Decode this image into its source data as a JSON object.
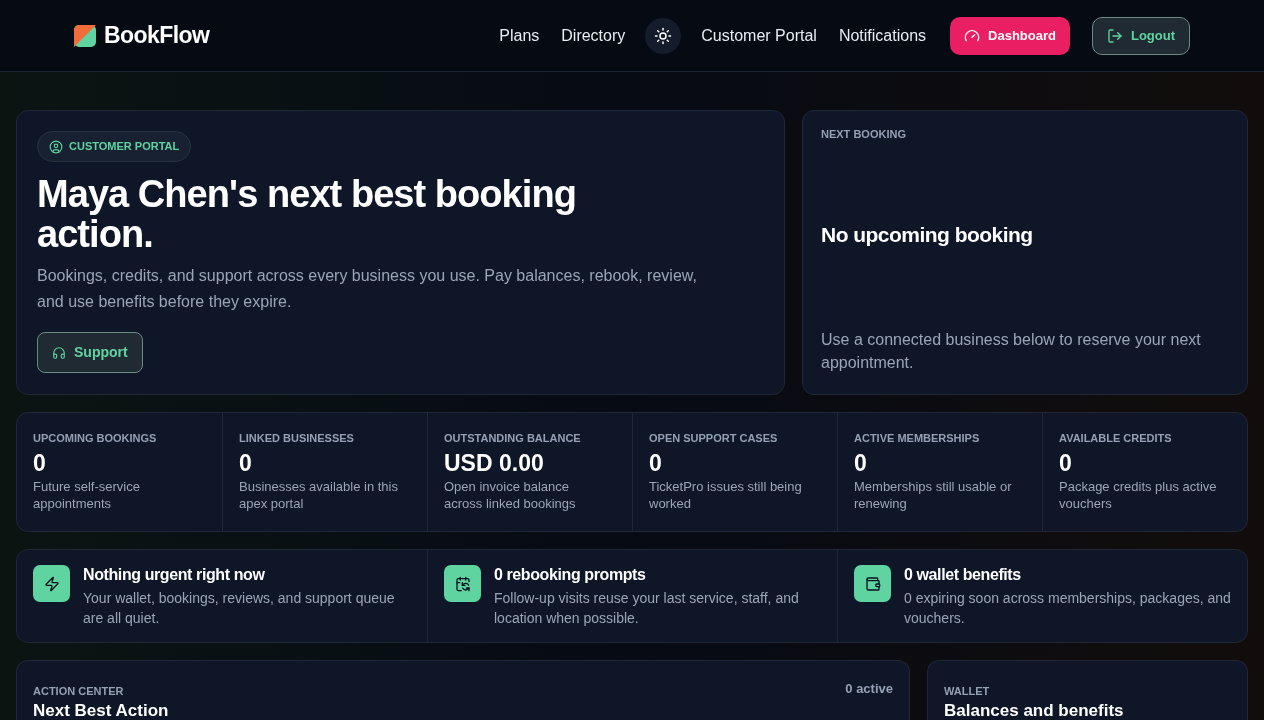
{
  "brand": "BookFlow",
  "nav": [
    "Plans",
    "Directory",
    "Customer Portal",
    "Notifications"
  ],
  "dashboard_button": "Dashboard",
  "logout_button": "Logout",
  "hero": {
    "badge": "CUSTOMER PORTAL",
    "title": "Maya Chen's next best booking action.",
    "body": "Bookings, credits, and support across every business you use. Pay balances, rebook, review, and use benefits before they expire.",
    "support_button": "Support"
  },
  "next_booking": {
    "label": "NEXT BOOKING",
    "title": "No upcoming booking",
    "body": "Use a connected business below to reserve your next appointment."
  },
  "stats": [
    {
      "label": "UPCOMING BOOKINGS",
      "value": "0",
      "note": "Future self-service appointments"
    },
    {
      "label": "LINKED BUSINESSES",
      "value": "0",
      "note": "Businesses available in this apex portal"
    },
    {
      "label": "OUTSTANDING BALANCE",
      "value": "USD 0.00",
      "note": "Open invoice balance across linked bookings"
    },
    {
      "label": "OPEN SUPPORT CASES",
      "value": "0",
      "note": "TicketPro issues still being worked"
    },
    {
      "label": "ACTIVE MEMBERSHIPS",
      "value": "0",
      "note": "Memberships still usable or renewing"
    },
    {
      "label": "AVAILABLE CREDITS",
      "value": "0",
      "note": "Package credits plus active vouchers"
    }
  ],
  "alerts": [
    {
      "kind": "urgent",
      "title": "Nothing urgent right now",
      "body": "Your wallet, bookings, reviews, and support queue are all quiet."
    },
    {
      "kind": "rebooking",
      "title": "0 rebooking prompts",
      "body": "Follow-up visits reuse your last service, staff, and location when possible."
    },
    {
      "kind": "wallet",
      "title": "0 wallet benefits",
      "body": "0 expiring soon across memberships, packages, and vouchers."
    }
  ],
  "action_center": {
    "label": "ACTION CENTER",
    "title": "Next Best Action",
    "count": "0 active"
  },
  "wallet": {
    "label": "WALLET",
    "title": "Balances and benefits"
  }
}
